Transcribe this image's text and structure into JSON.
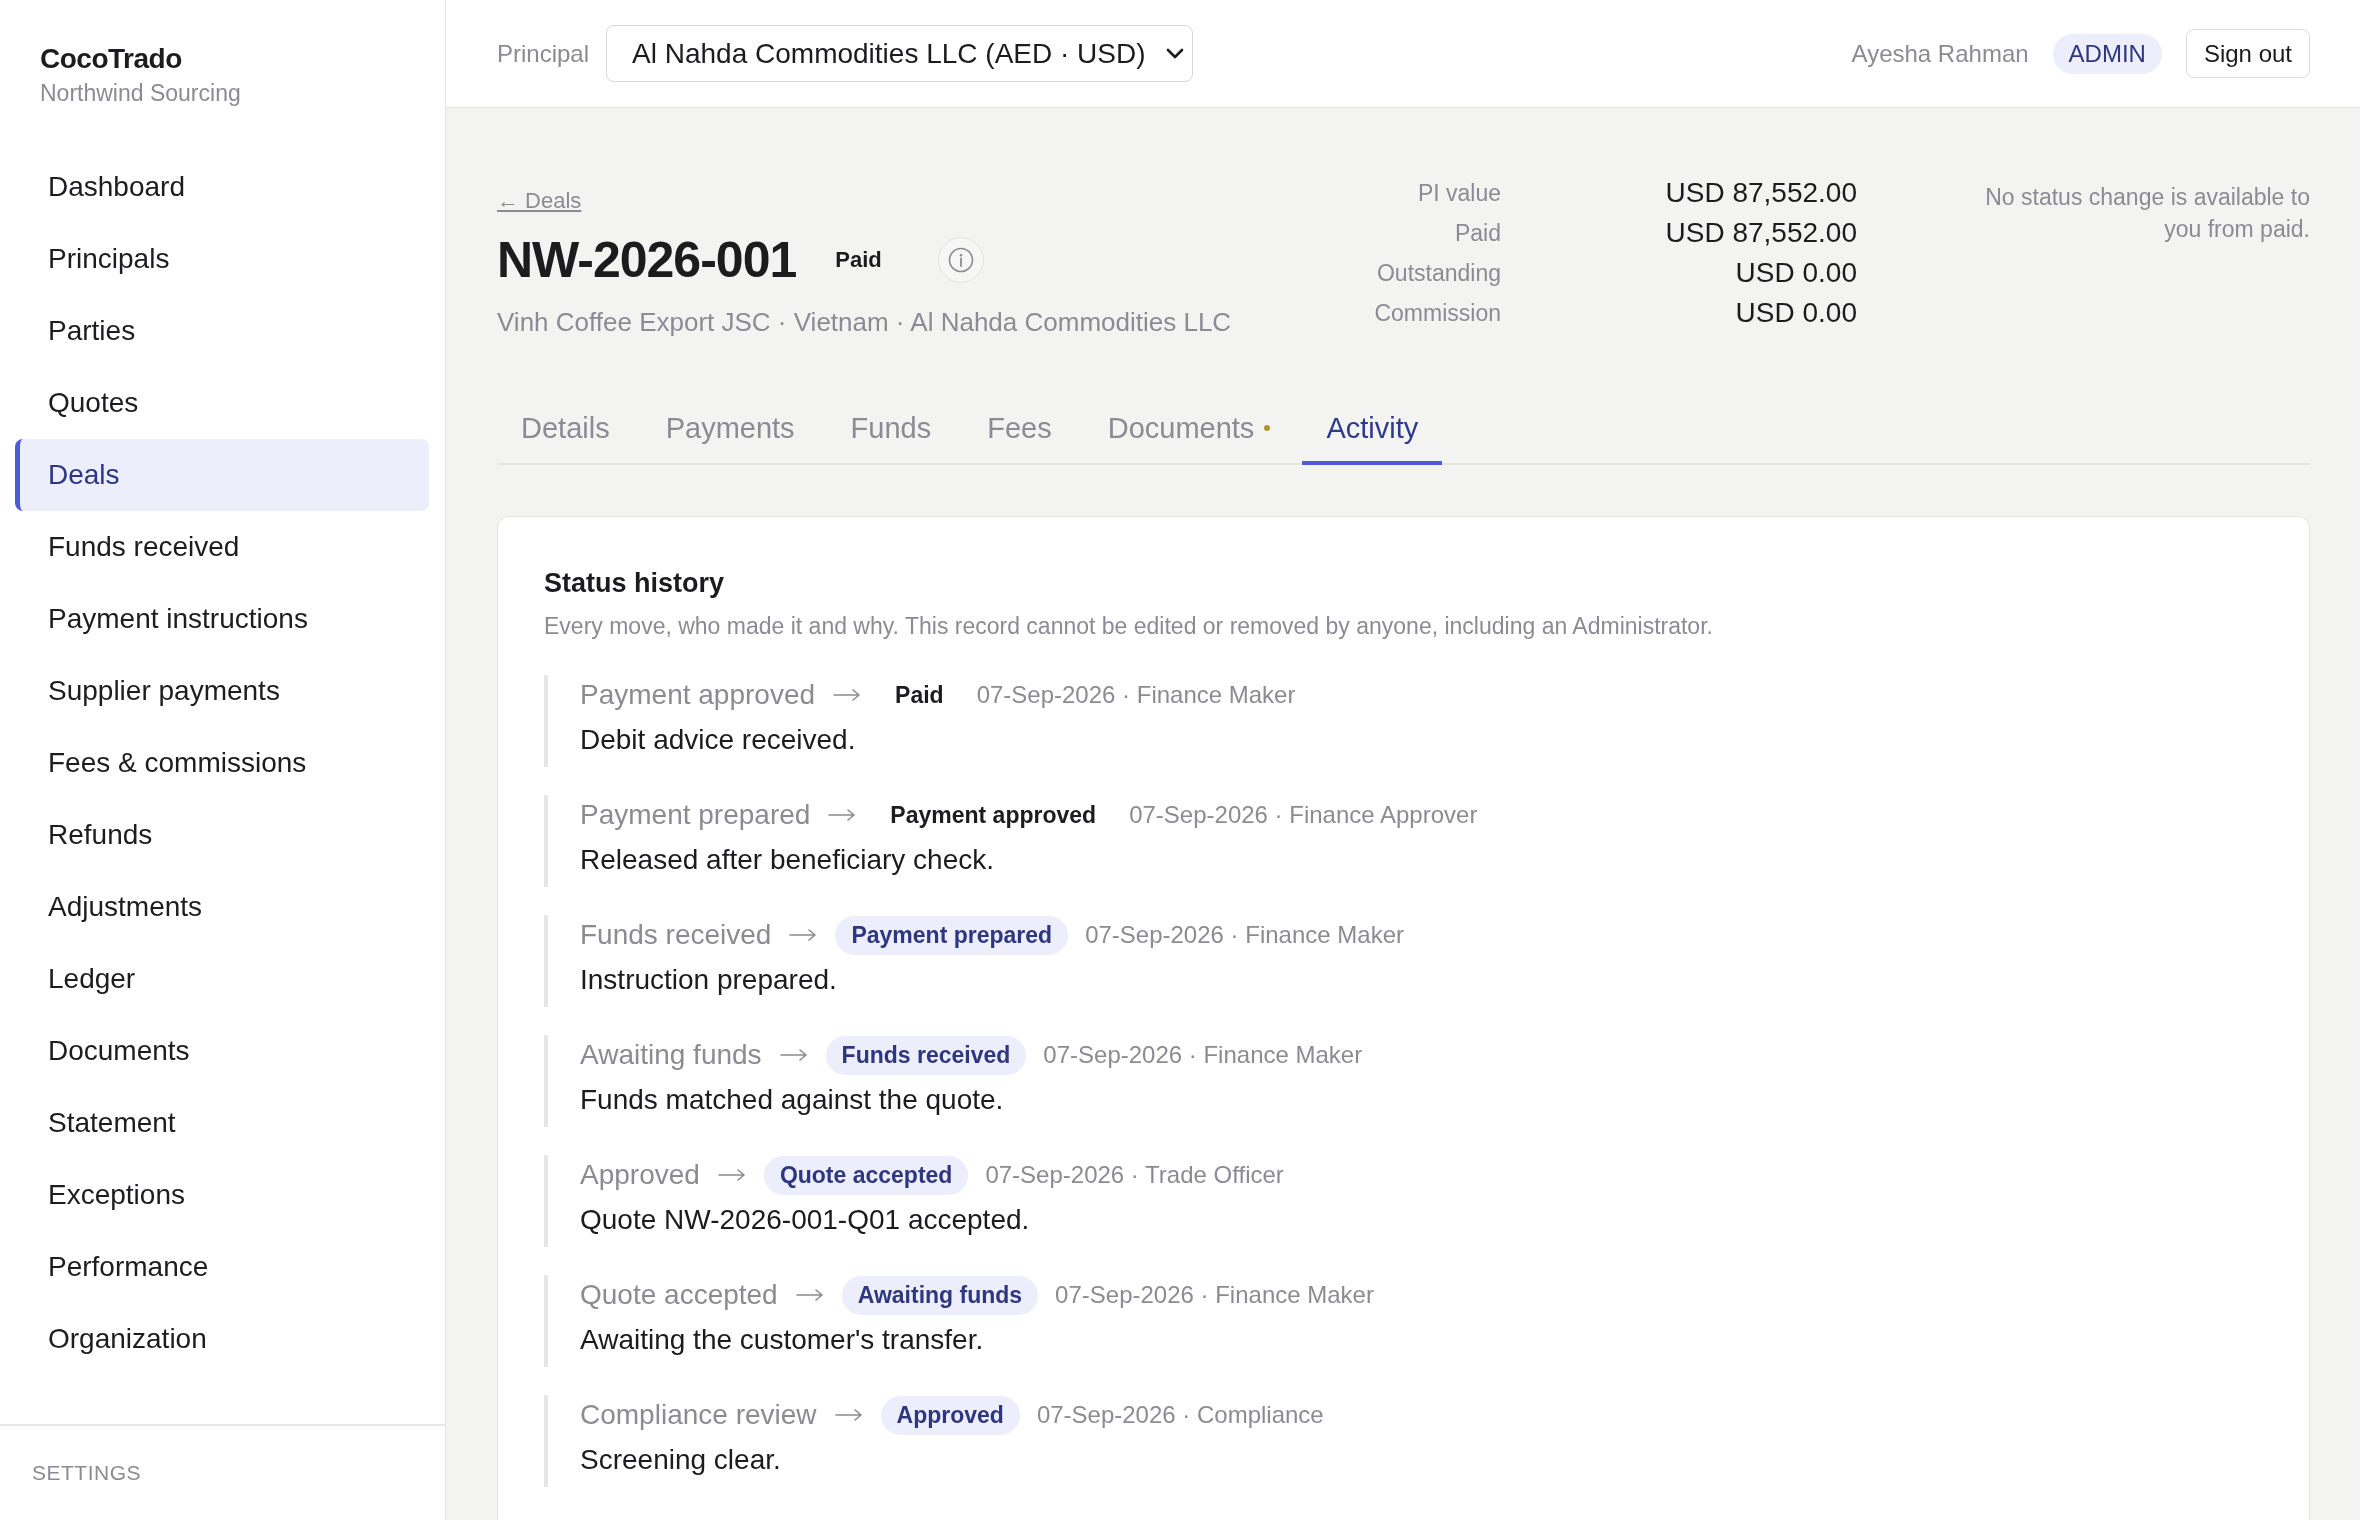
{
  "sidebar": {
    "brand": "CocoTrado",
    "org": "Northwind Sourcing",
    "items": [
      {
        "label": "Dashboard",
        "selected": false
      },
      {
        "label": "Principals",
        "selected": false
      },
      {
        "label": "Parties",
        "selected": false
      },
      {
        "label": "Quotes",
        "selected": false
      },
      {
        "label": "Deals",
        "selected": true
      },
      {
        "label": "Funds received",
        "selected": false
      },
      {
        "label": "Payment instructions",
        "selected": false
      },
      {
        "label": "Supplier payments",
        "selected": false
      },
      {
        "label": "Fees & commissions",
        "selected": false
      },
      {
        "label": "Refunds",
        "selected": false
      },
      {
        "label": "Adjustments",
        "selected": false
      },
      {
        "label": "Ledger",
        "selected": false
      },
      {
        "label": "Documents",
        "selected": false
      },
      {
        "label": "Statement",
        "selected": false
      },
      {
        "label": "Exceptions",
        "selected": false
      },
      {
        "label": "Performance",
        "selected": false
      },
      {
        "label": "Organization",
        "selected": false
      }
    ],
    "section_label": "SETTINGS"
  },
  "topbar": {
    "principal_label": "Principal",
    "principal_value": "Al Nahda Commodities LLC (AED · USD)",
    "user_name": "Ayesha Rahman",
    "role": "ADMIN",
    "sign_out": "Sign out"
  },
  "deal": {
    "back_link": "← Deals",
    "id": "NW-2026-001",
    "status": {
      "label": "Paid",
      "kind": "plain"
    },
    "subtitle": "Vinh Coffee Export JSC · Vietnam · Al Nahda Commodities LLC",
    "summary": [
      {
        "label": "PI value",
        "value": "USD 87,552.00"
      },
      {
        "label": "Paid",
        "value": "USD 87,552.00"
      },
      {
        "label": "Outstanding",
        "value": "USD 0.00"
      },
      {
        "label": "Commission",
        "value": "USD 0.00"
      }
    ],
    "status_note": "No status change is available to you from paid."
  },
  "tabs": [
    {
      "label": "Details",
      "selected": false,
      "indicator": false
    },
    {
      "label": "Payments",
      "selected": false,
      "indicator": false
    },
    {
      "label": "Funds",
      "selected": false,
      "indicator": false
    },
    {
      "label": "Fees",
      "selected": false,
      "indicator": false
    },
    {
      "label": "Documents",
      "selected": false,
      "indicator": true
    },
    {
      "label": "Activity",
      "selected": true,
      "indicator": false
    }
  ],
  "status_history": {
    "title": "Status history",
    "description": "Every move, who made it and why. This record cannot be edited or removed by anyone, including an Administrator.",
    "entries": [
      {
        "from": "Payment approved",
        "to": {
          "label": "Paid",
          "kind": "plain"
        },
        "meta": "07-Sep-2026 · Finance Maker",
        "note": "Debit advice received."
      },
      {
        "from": "Payment prepared",
        "to": {
          "label": "Payment approved",
          "kind": "plain"
        },
        "meta": "07-Sep-2026 · Finance Approver",
        "note": "Released after beneficiary check."
      },
      {
        "from": "Funds received",
        "to": {
          "label": "Payment prepared",
          "kind": "accent"
        },
        "meta": "07-Sep-2026 · Finance Maker",
        "note": "Instruction prepared."
      },
      {
        "from": "Awaiting funds",
        "to": {
          "label": "Funds received",
          "kind": "accent"
        },
        "meta": "07-Sep-2026 · Finance Maker",
        "note": "Funds matched against the quote."
      },
      {
        "from": "Approved",
        "to": {
          "label": "Quote accepted",
          "kind": "accent"
        },
        "meta": "07-Sep-2026 · Trade Officer",
        "note": "Quote NW-2026-001-Q01 accepted."
      },
      {
        "from": "Quote accepted",
        "to": {
          "label": "Awaiting funds",
          "kind": "accent"
        },
        "meta": "07-Sep-2026 · Finance Maker",
        "note": "Awaiting the customer's transfer."
      },
      {
        "from": "Compliance review",
        "to": {
          "label": "Approved",
          "kind": "accent"
        },
        "meta": "07-Sep-2026 · Compliance",
        "note": "Screening clear."
      }
    ]
  }
}
